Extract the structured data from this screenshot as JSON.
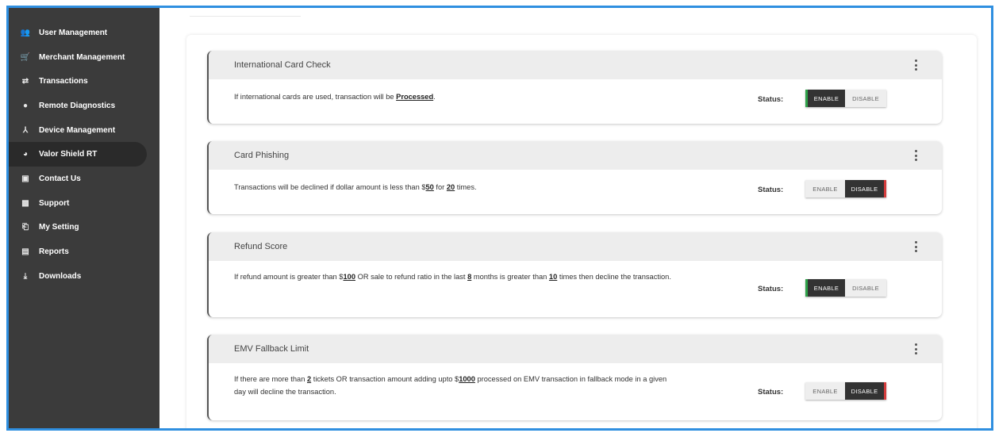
{
  "sidebar": {
    "items": [
      {
        "label": "User Management",
        "icon": "users-icon",
        "glyph": "👥"
      },
      {
        "label": "Merchant Management",
        "icon": "cart-icon",
        "glyph": "🛒"
      },
      {
        "label": "Transactions",
        "icon": "transfer-icon",
        "glyph": "⇄"
      },
      {
        "label": "Remote Diagnostics",
        "icon": "dot-icon",
        "glyph": "●"
      },
      {
        "label": "Device Management",
        "icon": "network-icon",
        "glyph": "⅄"
      },
      {
        "label": "Valor Shield RT",
        "icon": "shield-icon",
        "glyph": "◕",
        "active": true
      },
      {
        "label": "Contact Us",
        "icon": "contact-icon",
        "glyph": "▣"
      },
      {
        "label": "Support",
        "icon": "support-icon",
        "glyph": "▩"
      },
      {
        "label": "My Setting",
        "icon": "settings-icon",
        "glyph": "⎗"
      },
      {
        "label": "Reports",
        "icon": "report-icon",
        "glyph": "▤"
      },
      {
        "label": "Downloads",
        "icon": "download-icon",
        "glyph": "⤓"
      }
    ]
  },
  "status_label": "Status:",
  "toggle": {
    "enable": "ENABLE",
    "disable": "DISABLE"
  },
  "colors": {
    "sidebar": "#3b3b3b",
    "frame": "#2f8fe0",
    "enabled_accent": "#2fa24a",
    "disabled_accent": "#d33c3c"
  },
  "rules": [
    {
      "title": "International Card Check",
      "parts": [
        {
          "text": "If international cards are used, transaction will be "
        },
        {
          "text": "Processed",
          "bold": true
        },
        {
          "text": "."
        }
      ],
      "state": "enable"
    },
    {
      "title": "Card Phishing",
      "parts": [
        {
          "text": "Transactions will be declined if dollar amount is less than $"
        },
        {
          "text": "50",
          "bold": true
        },
        {
          "text": " for "
        },
        {
          "text": "20",
          "bold": true
        },
        {
          "text": " times."
        }
      ],
      "state": "disable"
    },
    {
      "title": "Refund Score",
      "parts": [
        {
          "text": "If refund amount is greater than $"
        },
        {
          "text": "100",
          "bold": true
        },
        {
          "text": " OR sale to refund ratio in the last "
        },
        {
          "text": "8",
          "bold": true
        },
        {
          "text": " months is greater than "
        },
        {
          "text": "10",
          "bold": true
        },
        {
          "text": " times then decline the transaction."
        }
      ],
      "state": "enable"
    },
    {
      "title": "EMV Fallback Limit",
      "parts": [
        {
          "text": "If there are more than "
        },
        {
          "text": "2",
          "bold": true
        },
        {
          "text": " tickets OR transaction amount adding upto $"
        },
        {
          "text": "1000",
          "bold": true
        },
        {
          "text": " processed on EMV transaction in fallback mode in a given day will decline the transaction."
        }
      ],
      "state": "disable"
    }
  ]
}
